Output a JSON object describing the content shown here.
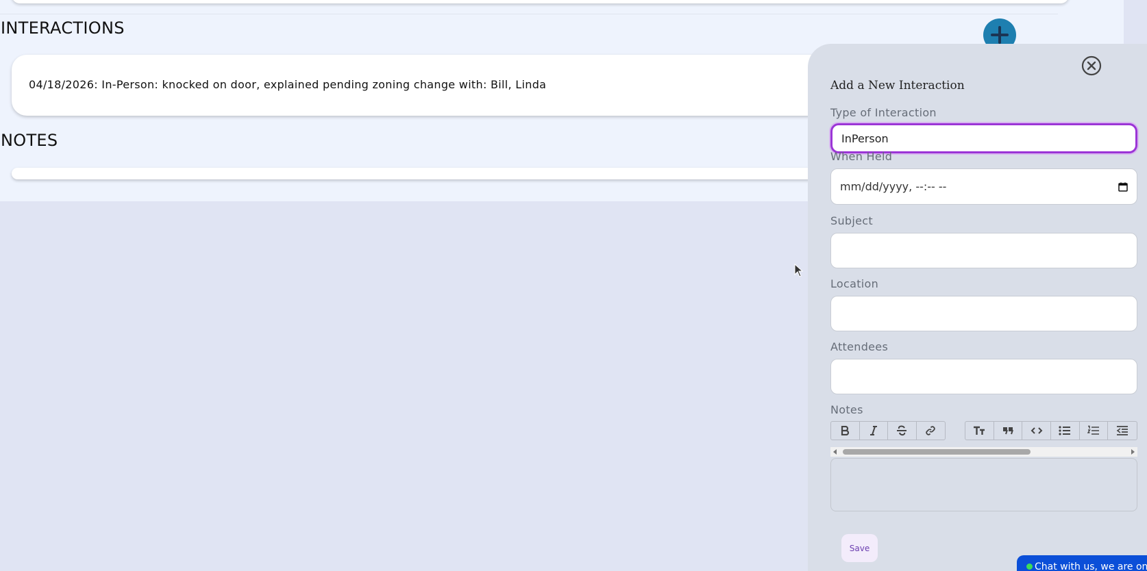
{
  "main": {
    "interactions_title": "INTERACTIONS",
    "notes_title": "NOTES",
    "interactions": [
      {
        "text": "04/18/2026: In-Person: knocked on door, explained pending zoning change with: Bill, Linda"
      }
    ]
  },
  "panel": {
    "title": "Add a New Interaction",
    "fields": {
      "type_label": "Type of Interaction",
      "type_value": "InPerson",
      "when_label": "When Held",
      "when_placeholder": "mm/dd/yyyy, --:-- --",
      "subject_label": "Subject",
      "location_label": "Location",
      "attendees_label": "Attendees",
      "notes_label": "Notes"
    },
    "toolbar": {
      "group1": [
        "bold-icon",
        "italic-icon",
        "strikethrough-icon",
        "link-icon"
      ],
      "group2": [
        "heading-icon",
        "quote-icon",
        "code-icon",
        "bullet-list-icon",
        "numbered-list-icon",
        "outdent-icon"
      ]
    },
    "save_label": "Save"
  },
  "chat": {
    "label": "Chat with us, we are online!"
  },
  "colors": {
    "accent": "#9b35d6",
    "fab": "#1e7fb0",
    "chat": "#0b4fd8",
    "panel_bg": "#d9dee8",
    "page_bg": "#eef3fd"
  }
}
